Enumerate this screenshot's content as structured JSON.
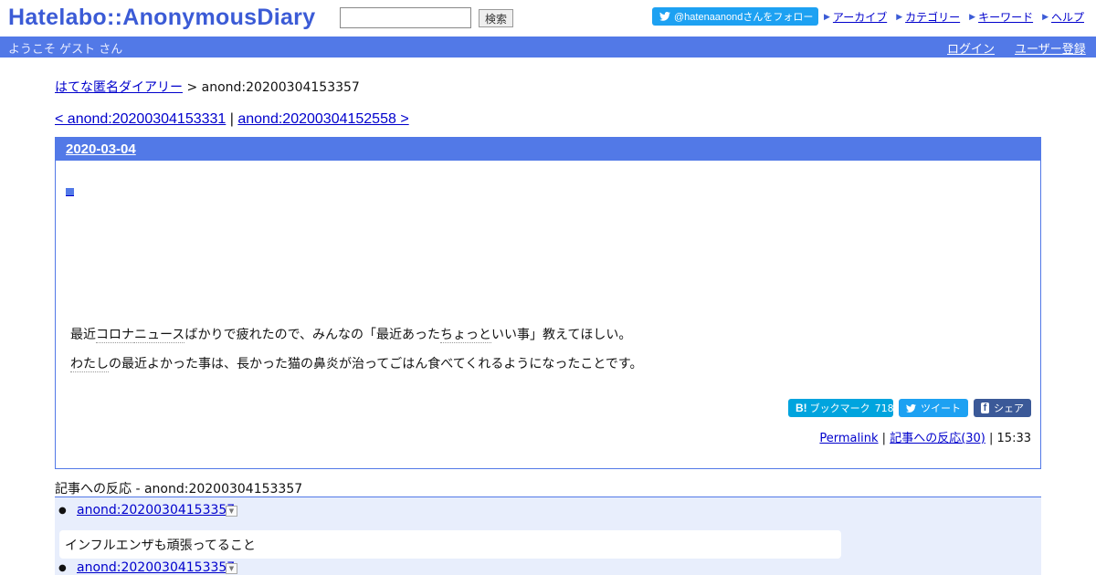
{
  "header": {
    "logo": "Hatelabo::AnonymousDiary",
    "search_placeholder": "",
    "search_button": "検索",
    "follow_label": "@hatenaanondさんをフォロー",
    "links": [
      "アーカイブ",
      "カテゴリー",
      "キーワード",
      "ヘルプ"
    ]
  },
  "navbar": {
    "welcome": "ようこそ ゲスト さん",
    "login": "ログイン",
    "register": "ユーザー登録"
  },
  "breadcrumb": {
    "home": "はてな匿名ダイアリー",
    "separator": " > ",
    "current": "anond:20200304153357"
  },
  "pager": {
    "prev": "< anond:20200304153331",
    "separator": " | ",
    "next": "anond:20200304152558 >"
  },
  "entry": {
    "date": "2020-03-04",
    "square": "■",
    "line1_pre": "最近",
    "line1_kw": "コロナ",
    "line1_mid": "ニュース",
    "line1_rest": "ばかりで疲れたので、みんなの「最近あった",
    "line1_kw2": "ちょっと",
    "line1_end": "いい事」教えてほしい。",
    "line2_kw": "わたし",
    "line2_rest": "の最近よかった事は、長かった猫の鼻炎が治ってごはん食べてくれるようになったことです。",
    "share": {
      "hatena_label": "ブックマーク",
      "hatena_count": "718",
      "tweet": "ツイート",
      "facebook": "シェア"
    },
    "permalink": "Permalink",
    "reactions_link": "記事への反応(30)",
    "time": "15:33"
  },
  "reactions": {
    "title": "記事への反応 - anond:20200304153357",
    "items": [
      {
        "link": "anond:20200304153357",
        "text": "インフルエンザも頑張ってること"
      },
      {
        "link": "anond:20200304153357",
        "text": ""
      }
    ]
  },
  "colors": {
    "accent": "#5279e7",
    "logo": "#3b5bd6",
    "twitter": "#1da1f2",
    "hatena": "#00a4de",
    "facebook": "#3b5998"
  }
}
